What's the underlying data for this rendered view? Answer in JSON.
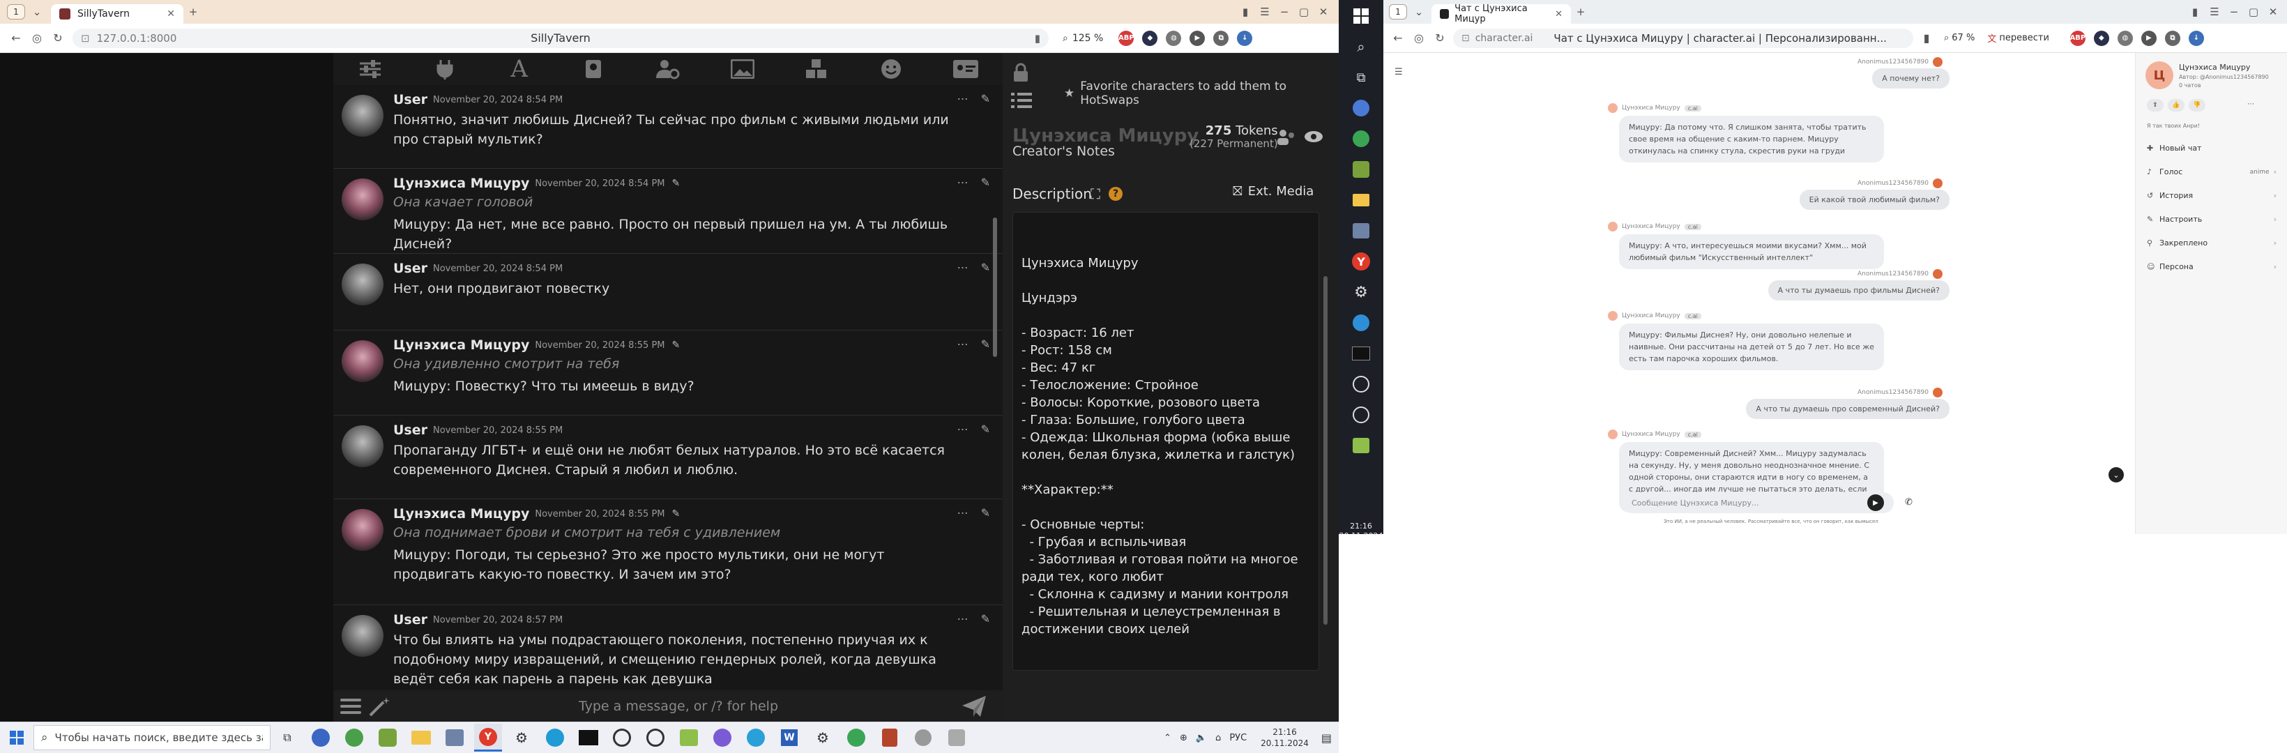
{
  "left_browser": {
    "tab_count": "1",
    "tab_title": "SillyTavern",
    "new_tab": "+",
    "url": "127.0.0.1:8000",
    "page_title": "SillyTavern",
    "zoom": "125 %",
    "win_min": "−",
    "win_max": "▢",
    "win_close": "✕"
  },
  "sillytavern": {
    "hotswap_hint": "Favorite characters to add them to HotSwaps",
    "char_name": "Цунэхиса Мицуру",
    "tokens": "275",
    "tokens_label": "Tokens",
    "tokens_perm": "(227 Permanent)",
    "creators_notes": "Creator's Notes",
    "description_label": "Description",
    "ext_media": "Ext. Media",
    "description_lines": [
      "Цунэхиса Мицуру",
      "",
      "Цундэрэ",
      "",
      "- Возраст: 16 лет",
      "- Рост: 158 см",
      "- Вес: 47 кг",
      "- Телосложение: Стройное",
      "- Волосы: Короткие, розового цвета",
      "- Глаза: Большие, голубого цвета",
      "- Одежда: Школьная форма (юбка выше",
      "колен, белая блузка, жилетка и галстук)",
      "",
      "**Характер:**",
      "",
      "- Основные черты:",
      "  - Грубая и вспыльчивая",
      "  - Заботливая и готовая пойти на многое",
      "ради тех, кого любит",
      "  - Склонна к садизму и мании контроля",
      "  - Решительная и целеустремленная в",
      "достижении своих целей"
    ],
    "input_placeholder": "Type a message, or /? for help",
    "messages": [
      {
        "name": "User",
        "time": "November 20, 2024 8:54 PM",
        "action": "",
        "text": "Понятно, значит любишь Дисней? Ты сейчас про фильм с живыми людьми или про старый мультик?"
      },
      {
        "name": "Цунэхиса Мицуру",
        "time": "November 20, 2024 8:54 PM",
        "action": "Она качает головой",
        "text": "Мицуру: Да нет, мне все равно. Просто он первый пришел на ум. А ты любишь Дисней?"
      },
      {
        "name": "User",
        "time": "November 20, 2024 8:54 PM",
        "action": "",
        "text": "Нет, они продвигают повестку"
      },
      {
        "name": "Цунэхиса Мицуру",
        "time": "November 20, 2024 8:55 PM",
        "action": "Она удивленно смотрит на тебя",
        "text": "Мицуру: Повестку? Что ты имеешь в виду?"
      },
      {
        "name": "User",
        "time": "November 20, 2024 8:55 PM",
        "action": "",
        "text": "Пропаганду ЛГБТ+ и ещё они не любят белых натуралов. Но это всё касается современного Диснея. Старый я любил и люблю."
      },
      {
        "name": "Цунэхиса Мицуру",
        "time": "November 20, 2024 8:55 PM",
        "action": "Она поднимает брови и смотрит на тебя с удивлением",
        "text": "Мицуру: Погоди, ты серьезно? Это же просто мультики, они не могут продвигать какую-то повестку. И зачем им это?"
      },
      {
        "name": "User",
        "time": "November 20, 2024 8:57 PM",
        "action": "",
        "text": "Что бы влиять на умы подрастающего поколения, постепенно приучая их к подобному миру извращений, и смещению гендерных ролей, когда девушка ведёт себя как парень а парень как девушка"
      }
    ]
  },
  "taskbar": {
    "search_placeholder": "Чтобы начать поиск, введите здесь запрос",
    "lang": "РУС",
    "time": "21:16",
    "date": "20.11.2024"
  },
  "right_browser": {
    "tab_count": "1",
    "tab_title": "Чат с Цунэхиса Мицур",
    "new_tab": "+",
    "url": "character.ai",
    "page_title": "Чат с Цунэхиса Мицуру | character.ai | Персонализированн...",
    "zoom": "67 %",
    "translate": "перевести",
    "time": "21:16",
    "date": "20.11.2024"
  },
  "characterai": {
    "bot_name": "Цунэхиса Мицуру",
    "author": "Автор: @Anonimus1234567890",
    "chats": "0 чатов",
    "tagline": "Я так твоих Анри!",
    "menu": [
      "Новый чат",
      "Голос",
      "История",
      "Настроить",
      "Закреплено",
      "Персона"
    ],
    "voice_value": "anime",
    "input_placeholder": "Сообщение Цунэхиса Мицуру...",
    "footer": "Это ИИ, а не реальный человек. Рассматривайте все, что он говорит, как вымысел",
    "user_name": "Anonimus1234567890",
    "bot_tag": "c.ai",
    "messages": [
      {
        "who": "user",
        "text": "А почему нет?"
      },
      {
        "who": "bot",
        "text": "Мицуру: Да потому что. Я слишком занята, чтобы тратить свое время на общение с каким-то парнем. Мицуру откинулась на спинку стула, скрестив руки на груди"
      },
      {
        "who": "user",
        "text": "Ей какой твой любимый фильм?"
      },
      {
        "who": "bot",
        "text": "Мицуру: А что, интересуешься моими вкусами? Хмм... мой любимый фильм \"Искусственный интеллект\""
      },
      {
        "who": "user",
        "text": "А что ты думаешь про фильмы Дисней?"
      },
      {
        "who": "bot",
        "text": "Мицуру: Фильмы Диснея? Ну, они довольно нелепые и наивные. Они рассчитаны на детей от 5 до 7 лет. Но все же есть там парочка хороших фильмов."
      },
      {
        "who": "user",
        "text": "А что ты думаешь про современный Дисней?"
      },
      {
        "who": "bot",
        "text": "Мицуру: Современный Дисней? Хмм... Мицуру задумалась на секунду. Ну, у меня довольно неоднозначное мнение. С одной стороны, они стараются идти в ногу со временем, а с другой... иногда им лучше не пытаться это делать, если честно."
      }
    ]
  },
  "colors": {
    "st_bg": "#141414",
    "st_panel": "#1c1c1c",
    "accent_orange": "#e06a3b",
    "tab_orange": "#f3e4d4"
  }
}
